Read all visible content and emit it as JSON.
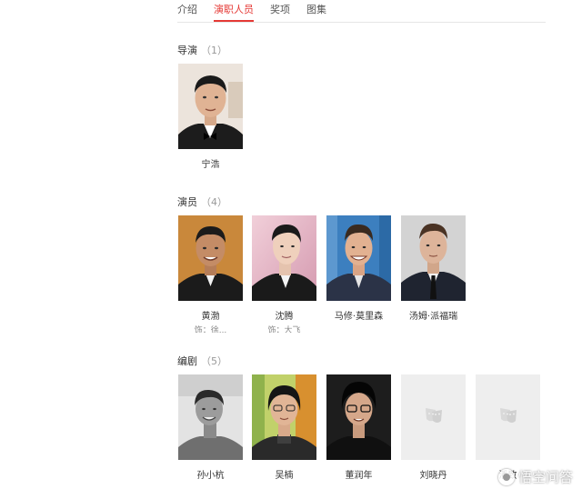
{
  "tabs": [
    {
      "label": "介绍",
      "active": false
    },
    {
      "label": "演职人员",
      "active": true
    },
    {
      "label": "奖项",
      "active": false
    },
    {
      "label": "图集",
      "active": false
    }
  ],
  "sections": {
    "director": {
      "title": "导演",
      "count": "（1）",
      "people": [
        {
          "name": "宁浩",
          "role": ""
        }
      ]
    },
    "actors": {
      "title": "演员",
      "count": "（4）",
      "people": [
        {
          "name": "黄渤",
          "role": "饰：徐... "
        },
        {
          "name": "沈腾",
          "role": "饰：大飞"
        },
        {
          "name": "马修·莫里森",
          "role": ""
        },
        {
          "name": "汤姆·派福瑞",
          "role": ""
        }
      ]
    },
    "writers": {
      "title": "编剧",
      "count": "（5）",
      "people": [
        {
          "name": "孙小杭",
          "role": ""
        },
        {
          "name": "吴楠",
          "role": ""
        },
        {
          "name": "董润年",
          "role": ""
        },
        {
          "name": "刘晓丹",
          "role": ""
        },
        {
          "name": "潘致",
          "role": ""
        }
      ]
    }
  },
  "watermark": {
    "text": "悟空问答"
  },
  "colors": {
    "accent": "#e53935",
    "placeholder_bg": "#eeeeee"
  }
}
